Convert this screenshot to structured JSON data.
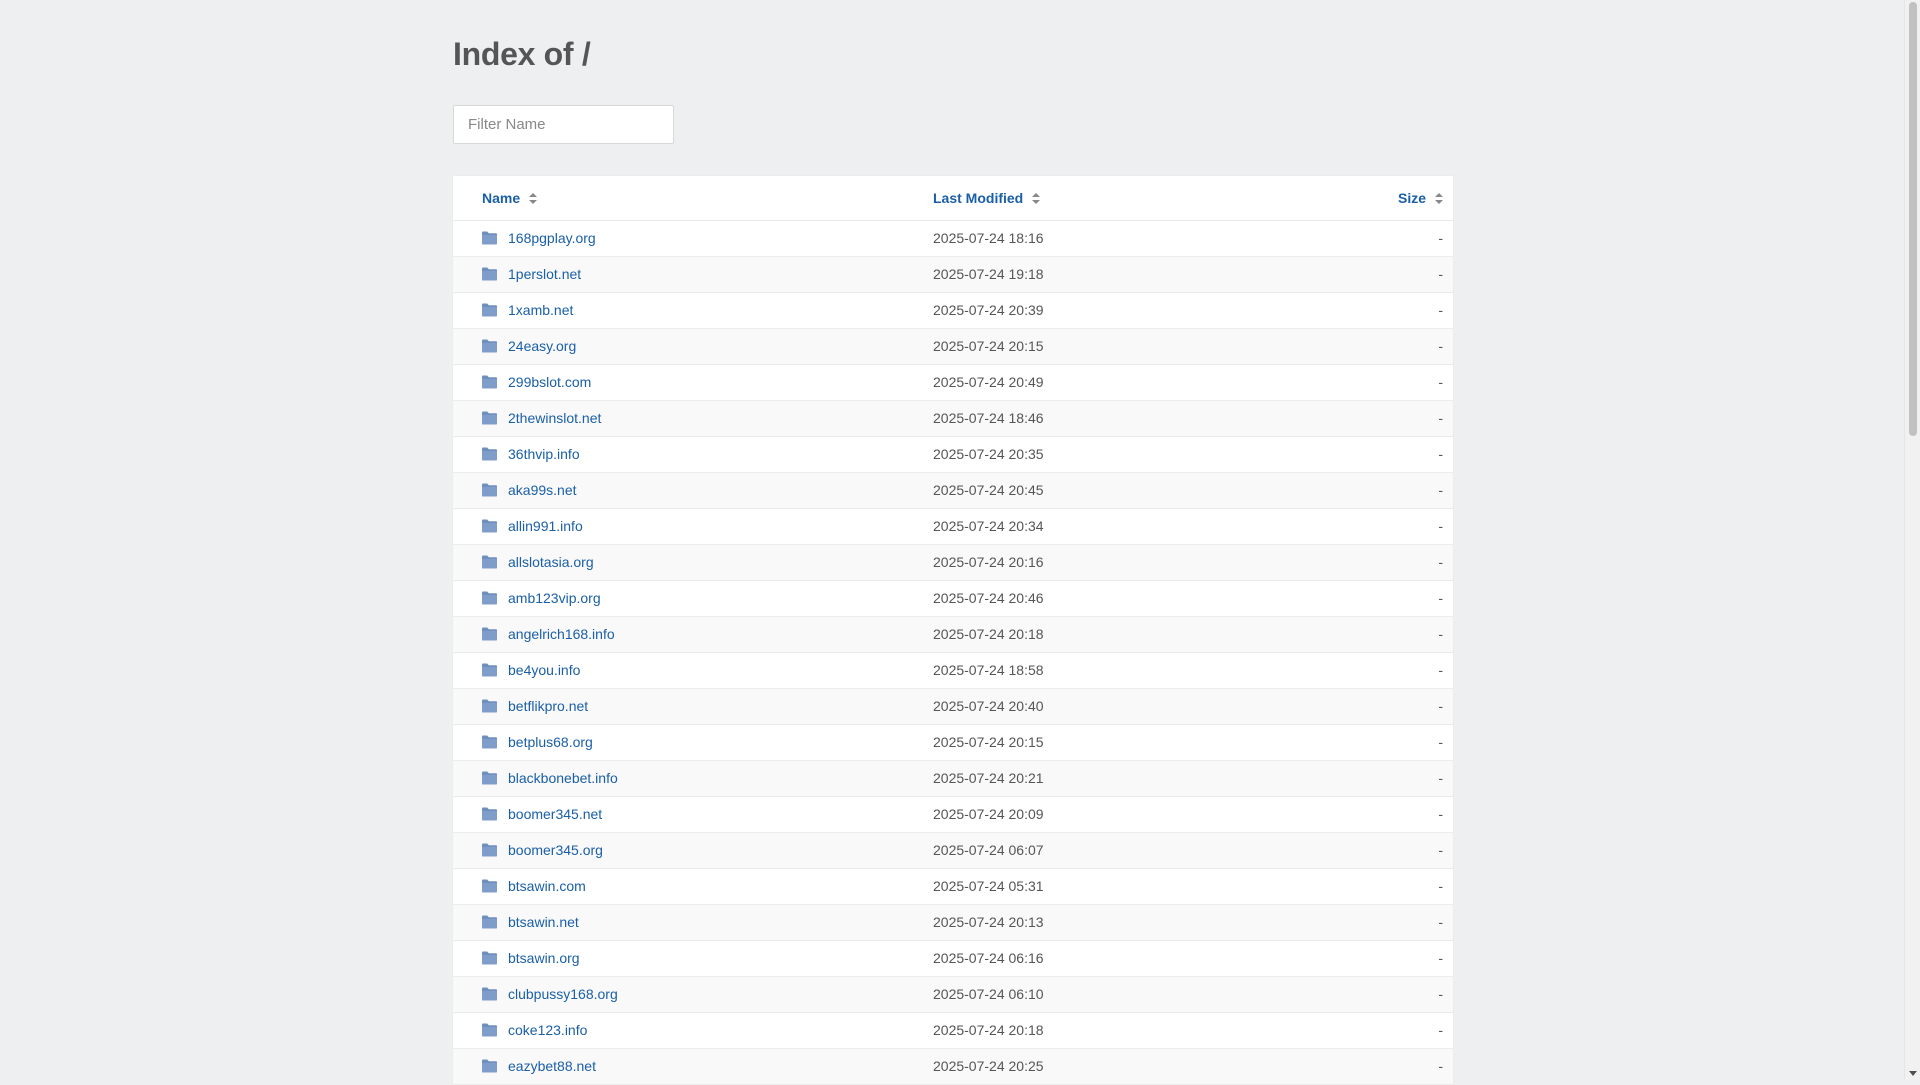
{
  "page": {
    "title": "Index of /",
    "filter_placeholder": "Filter Name"
  },
  "columns": {
    "name": "Name",
    "modified": "Last Modified",
    "size": "Size"
  },
  "entries": [
    {
      "name": "168pgplay.org",
      "modified": "2025-07-24 18:16",
      "size": "-"
    },
    {
      "name": "1perslot.net",
      "modified": "2025-07-24 19:18",
      "size": "-"
    },
    {
      "name": "1xamb.net",
      "modified": "2025-07-24 20:39",
      "size": "-"
    },
    {
      "name": "24easy.org",
      "modified": "2025-07-24 20:15",
      "size": "-"
    },
    {
      "name": "299bslot.com",
      "modified": "2025-07-24 20:49",
      "size": "-"
    },
    {
      "name": "2thewinslot.net",
      "modified": "2025-07-24 18:46",
      "size": "-"
    },
    {
      "name": "36thvip.info",
      "modified": "2025-07-24 20:35",
      "size": "-"
    },
    {
      "name": "aka99s.net",
      "modified": "2025-07-24 20:45",
      "size": "-"
    },
    {
      "name": "allin991.info",
      "modified": "2025-07-24 20:34",
      "size": "-"
    },
    {
      "name": "allslotasia.org",
      "modified": "2025-07-24 20:16",
      "size": "-"
    },
    {
      "name": "amb123vip.org",
      "modified": "2025-07-24 20:46",
      "size": "-"
    },
    {
      "name": "angelrich168.info",
      "modified": "2025-07-24 20:18",
      "size": "-"
    },
    {
      "name": "be4you.info",
      "modified": "2025-07-24 18:58",
      "size": "-"
    },
    {
      "name": "betflikpro.net",
      "modified": "2025-07-24 20:40",
      "size": "-"
    },
    {
      "name": "betplus68.org",
      "modified": "2025-07-24 20:15",
      "size": "-"
    },
    {
      "name": "blackbonebet.info",
      "modified": "2025-07-24 20:21",
      "size": "-"
    },
    {
      "name": "boomer345.net",
      "modified": "2025-07-24 20:09",
      "size": "-"
    },
    {
      "name": "boomer345.org",
      "modified": "2025-07-24 06:07",
      "size": "-"
    },
    {
      "name": "btsawin.com",
      "modified": "2025-07-24 05:31",
      "size": "-"
    },
    {
      "name": "btsawin.net",
      "modified": "2025-07-24 20:13",
      "size": "-"
    },
    {
      "name": "btsawin.org",
      "modified": "2025-07-24 06:16",
      "size": "-"
    },
    {
      "name": "clubpussy168.org",
      "modified": "2025-07-24 06:10",
      "size": "-"
    },
    {
      "name": "coke123.info",
      "modified": "2025-07-24 20:18",
      "size": "-"
    },
    {
      "name": "eazybet88.net",
      "modified": "2025-07-24 20:25",
      "size": "-"
    }
  ],
  "icons": {
    "folder": "folder-icon",
    "sort": "sort-icon"
  },
  "colors": {
    "link": "#1a5fa8",
    "folder": "#6f8fbf",
    "background": "#eeeff1"
  }
}
